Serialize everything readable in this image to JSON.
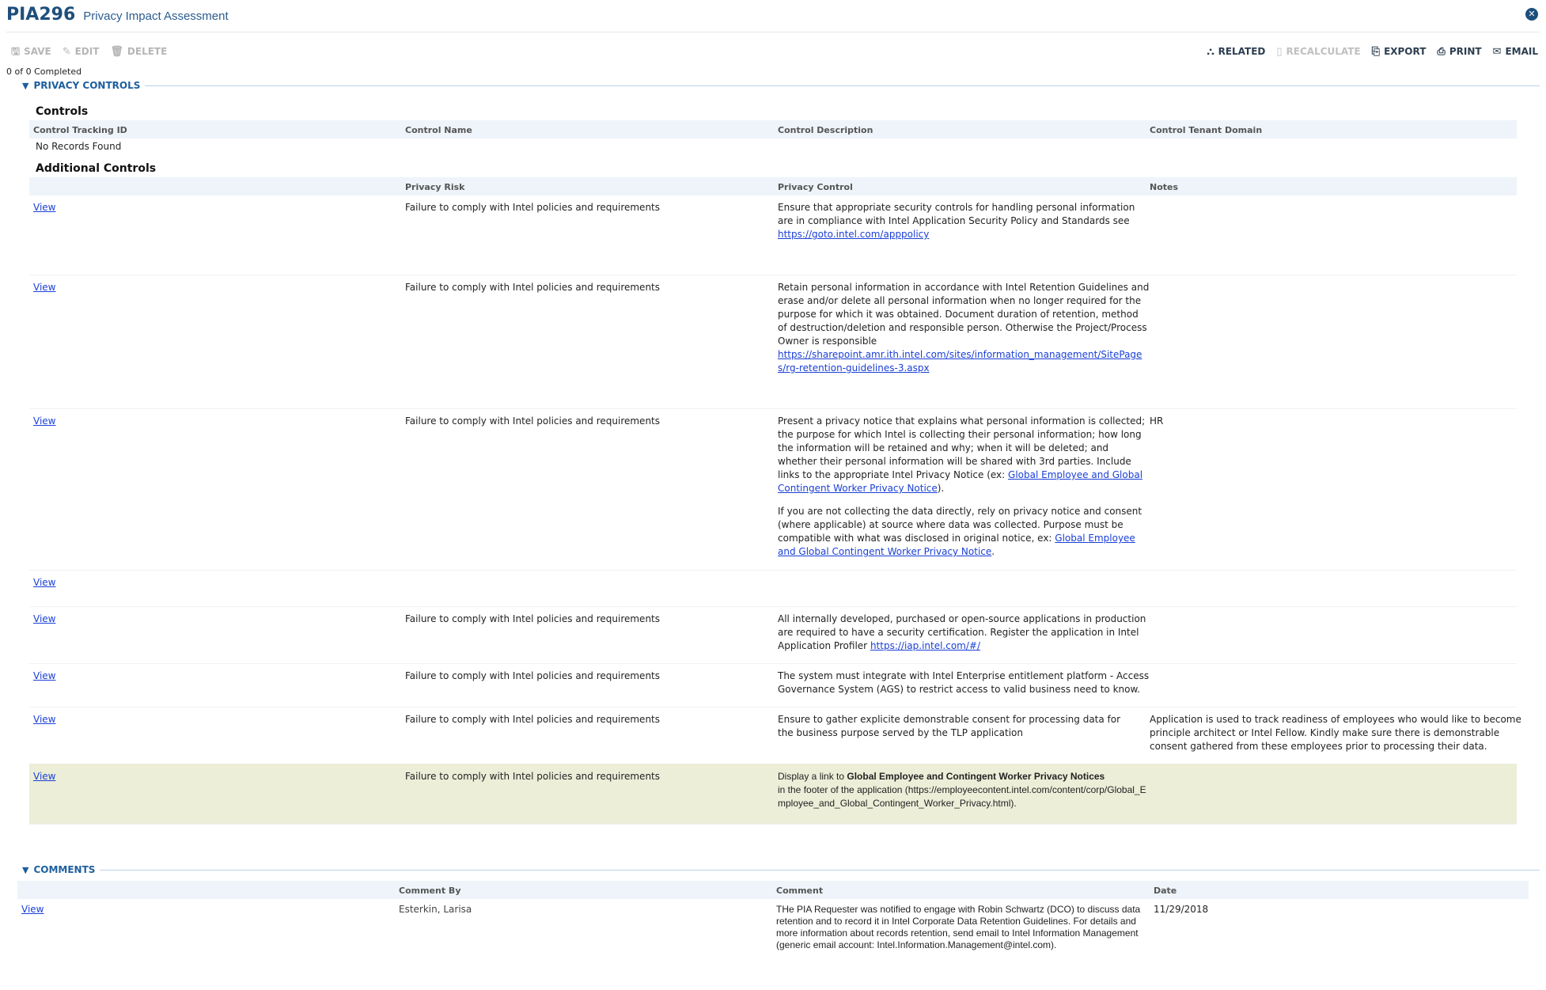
{
  "header": {
    "record_id": "PIA296",
    "title": "Privacy Impact Assessment"
  },
  "toolbar": {
    "left": [
      {
        "label": "SAVE",
        "icon": "save-icon"
      },
      {
        "label": "EDIT",
        "icon": "pencil-icon"
      },
      {
        "label": "DELETE",
        "icon": "trash-icon"
      }
    ],
    "right": [
      {
        "label": "RELATED",
        "icon": "hierarchy-icon"
      },
      {
        "label": "RECALCULATE",
        "icon": "calculator-icon"
      },
      {
        "label": "EXPORT",
        "icon": "export-icon"
      },
      {
        "label": "PRINT",
        "icon": "printer-icon"
      },
      {
        "label": "EMAIL",
        "icon": "envelope-icon"
      }
    ]
  },
  "progress": "0 of 0 Completed",
  "privacy_controls": {
    "section_label": "PRIVACY CONTROLS",
    "controls": {
      "heading": "Controls",
      "columns": [
        "Control Tracking ID",
        "Control Name",
        "Control Description",
        "Control Tenant Domain"
      ],
      "empty_text": "No Records Found"
    },
    "additional": {
      "heading": "Additional Controls",
      "columns": [
        "Privacy Risk",
        "Privacy Control",
        "Notes"
      ],
      "view_label": "View",
      "rows": [
        {
          "risk": "Failure to comply with Intel policies and requirements",
          "control_text": "Ensure that appropriate security controls for handling personal information are in compliance with Intel Application Security Policy and Standards see ",
          "control_link": "https://goto.intel.com/apppolicy",
          "notes": ""
        },
        {
          "risk": "Failure to comply with Intel policies and requirements",
          "control_text": "Retain personal information in accordance with Intel Retention Guidelines and erase and/or delete all personal information when no longer required for the purpose for which it was obtained. Document duration of retention, method of destruction/deletion and responsible person. Otherwise the Project/Process Owner is responsible",
          "control_link": "https://sharepoint.amr.ith.intel.com/sites/information_management/SitePages/rg-retention-guidelines-3.aspx",
          "notes": ""
        },
        {
          "risk": "Failure to comply with Intel policies and requirements",
          "control_p1": "Present a privacy notice that explains what personal information is collected; the purpose for which Intel is collecting their personal information; how long the information will be retained and why; when it will be deleted; and whether their personal information will be shared with 3rd parties. Include links to the appropriate Intel Privacy Notice (ex: ",
          "control_p1_link": "Global Employee and Global Contingent Worker Privacy Notice",
          "control_p1_end": ").",
          "control_p2": "If you are not collecting the data directly, rely on privacy notice and consent (where applicable) at source where data was collected. Purpose must be compatible with what was disclosed in original notice, ex: ",
          "control_p2_link": "Global Employee and Global Contingent Worker Privacy Notice",
          "control_p2_end": ".",
          "notes": "HR"
        },
        {
          "risk": "",
          "control_text": "",
          "notes": ""
        },
        {
          "risk": "Failure to comply with Intel policies and requirements",
          "control_text": "All internally developed, purchased or open-source applications in production are required to have a security certification. Register the application in Intel Application Profiler ",
          "control_link": "https://iap.intel.com/#/",
          "notes": ""
        },
        {
          "risk": "Failure to comply with Intel policies and requirements",
          "control_text": "The system must integrate with Intel Enterprise entitlement platform - Access Governance System (AGS) to restrict access to valid business need to know.",
          "notes": ""
        },
        {
          "risk": "Failure to comply with Intel policies and requirements",
          "control_text": "Ensure to gather explicite demonstrable consent  for processing data for the business purpose served by the TLP application",
          "notes": "Application is used to track readiness of employees who would like to become principle architect or Intel Fellow. Kindly make sure there is demonstrable consent gathered from these employees prior to processing their data."
        },
        {
          "risk": "Failure to comply with Intel policies and requirements",
          "control_pre": "Display a link to ",
          "control_bold": "Global Employee and Contingent Worker Privacy Notices",
          "control_post": "in the footer of the application (https://employeecontent.intel.com/content/corp/Global_Employee_and_Global_Contingent_Worker_Privacy.html).",
          "notes": ""
        }
      ]
    }
  },
  "comments": {
    "section_label": "COMMENTS",
    "columns": [
      "Comment By",
      "Comment",
      "Date"
    ],
    "rows": [
      {
        "view": "View",
        "by": "Esterkin, Larisa",
        "comment": "THe PIA Requester was notified to engage with Robin Schwartz (DCO) to discuss data retention and to record it in Intel Corporate Data Retention Guidelines. For details and more information about records retention, send email to Intel Information Management (generic email account: Intel.Information.Management@intel.com).",
        "date": "11/29/2018"
      }
    ]
  }
}
